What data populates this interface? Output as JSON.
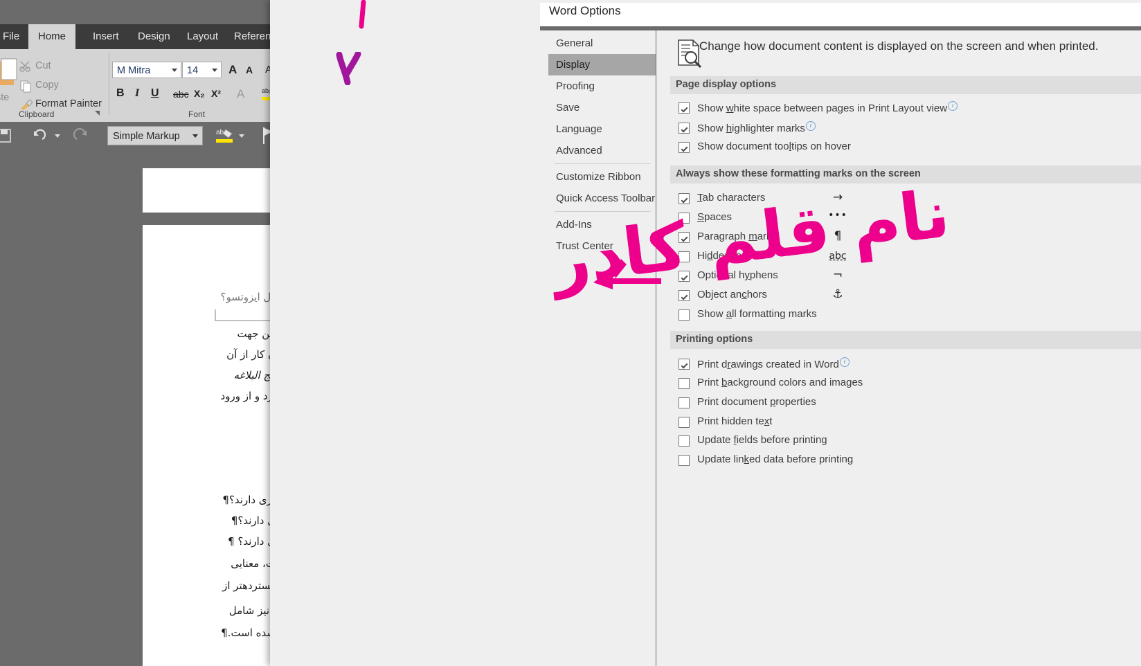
{
  "colors": {
    "ink_pink": "#ec008c",
    "ink_purple": "#a0179c",
    "accent_teal": "#11bf9a",
    "dialog_bg": "#efefef",
    "section_bg": "#dedede",
    "nav_selected": "#a6a6a6"
  },
  "word": {
    "tabs": [
      {
        "label": "File",
        "active": false
      },
      {
        "label": "Home",
        "active": true
      },
      {
        "label": "Insert",
        "active": false
      },
      {
        "label": "Design",
        "active": false
      },
      {
        "label": "Layout",
        "active": false
      },
      {
        "label": "References",
        "active": false
      }
    ],
    "clipboard": {
      "group_label": "Clipboard",
      "paste_label": "ste",
      "cut_label": "Cut",
      "copy_label": "Copy",
      "format_painter_label": "Format Painter",
      "cut_icon": "scissors-icon",
      "copy_icon": "copy-icon",
      "format_painter_icon": "paintbrush-icon",
      "dialog_launcher_icon": "dialog-launcher-icon"
    },
    "font_group": {
      "group_label": "Font",
      "font_name": "M Mitra",
      "font_size": "14",
      "grow_font": "A",
      "shrink_font": "A",
      "change_case": "Aa",
      "bold": "B",
      "italic": "I",
      "underline": "U",
      "strikethrough": "abc",
      "subscript": "X₂",
      "superscript": "X²",
      "text_effects": "A",
      "highlight_icon": "text-highlight-icon"
    },
    "quick_access": {
      "save_icon": "save-icon",
      "undo_icon": "undo-icon",
      "redo_icon": "redo-icon",
      "markup_value": "Simple Markup",
      "highlight_icon": "text-highlight-icon",
      "flag_icon": "flag-icon"
    },
    "document_lines": [
      {
        "text": "دل ایزوتسو؟",
        "style": "gray"
      },
      {
        "text": "این جهت",
        "style": "normal"
      },
      {
        "text": "ن کار از آن",
        "style": "normal"
      },
      {
        "text": "هج البلاغه",
        "style": "italic"
      },
      {
        "text": "ارد و از ورود",
        "style": "normal"
      },
      {
        "text": "یری دارند؟¶",
        "style": "normal"
      },
      {
        "text": "ی دارند؟¶",
        "style": "normal"
      },
      {
        "text": "ی دارند؟ ¶",
        "style": "normal"
      },
      {
        "text": "ت، معنایی",
        "style": "normal"
      },
      {
        "text": "گستردهتر از",
        "style": "normal"
      },
      {
        "text": "ا نیز شامل",
        "style": "normal"
      },
      {
        "text": "شده است.¶",
        "style": "normal"
      }
    ]
  },
  "dialog": {
    "title": "Word Options",
    "help_button": "?",
    "close_button": "✕",
    "header_icon": "document-search-icon",
    "header_text": "Change how document content is displayed on the screen and when printed.",
    "nav": {
      "groups": [
        {
          "items": [
            {
              "label": "General",
              "selected": false
            },
            {
              "label": "Display",
              "selected": true
            },
            {
              "label": "Proofing",
              "selected": false
            },
            {
              "label": "Save",
              "selected": false
            },
            {
              "label": "Language",
              "selected": false
            },
            {
              "label": "Advanced",
              "selected": false
            }
          ]
        },
        {
          "items": [
            {
              "label": "Customize Ribbon",
              "selected": false
            },
            {
              "label": "Quick Access Toolbar",
              "selected": false
            }
          ]
        },
        {
          "items": [
            {
              "label": "Add-Ins",
              "selected": false
            },
            {
              "label": "Trust Center",
              "selected": false
            }
          ]
        }
      ]
    },
    "sections": [
      {
        "title": "Page display options",
        "items": [
          {
            "label_pre": "Show ",
            "label_key": "w",
            "label_post": "hite space between pages in Print Layout view",
            "checked": true,
            "info": true,
            "mark": ""
          },
          {
            "label_pre": "Show ",
            "label_key": "h",
            "label_post": "ighlighter marks",
            "checked": true,
            "info": true,
            "mark": ""
          },
          {
            "label_pre": "Show document too",
            "label_key": "l",
            "label_post": "tips on hover",
            "checked": true,
            "info": false,
            "mark": ""
          }
        ]
      },
      {
        "title": "Always show these formatting marks on the screen",
        "items": [
          {
            "label_pre": "",
            "label_key": "T",
            "label_post": "ab characters",
            "checked": true,
            "info": false,
            "mark": "→",
            "mark_kind": "arrow"
          },
          {
            "label_pre": "",
            "label_key": "S",
            "label_post": "paces",
            "checked": false,
            "info": false,
            "mark": "•••",
            "mark_kind": "dots"
          },
          {
            "label_pre": "Paragraph ",
            "label_key": "m",
            "label_post": "arks",
            "checked": true,
            "info": false,
            "mark": "¶",
            "mark_kind": "pilcrow"
          },
          {
            "label_pre": "Hi",
            "label_key": "d",
            "label_post": "den text",
            "checked": false,
            "info": false,
            "mark": "abc",
            "mark_kind": "abc"
          },
          {
            "label_pre": "Optional h",
            "label_key": "y",
            "label_post": "phens",
            "checked": true,
            "info": false,
            "mark": "¬",
            "mark_kind": "hyphen"
          },
          {
            "label_pre": "Object an",
            "label_key": "c",
            "label_post": "hors",
            "checked": true,
            "info": false,
            "mark": "⚓",
            "mark_kind": "anchor"
          },
          {
            "label_pre": "Show ",
            "label_key": "a",
            "label_post": "ll formatting marks",
            "checked": false,
            "info": false,
            "mark": ""
          }
        ]
      },
      {
        "title": "Printing options",
        "items": [
          {
            "label_pre": "Print d",
            "label_key": "r",
            "label_post": "awings created in Word",
            "checked": true,
            "info": true,
            "mark": ""
          },
          {
            "label_pre": "Print ",
            "label_key": "b",
            "label_post": "ackground colors and images",
            "checked": false,
            "info": false,
            "mark": ""
          },
          {
            "label_pre": "Print document ",
            "label_key": "p",
            "label_post": "roperties",
            "checked": false,
            "info": false,
            "mark": ""
          },
          {
            "label_pre": "Print hidden te",
            "label_key": "x",
            "label_post": "t",
            "checked": false,
            "info": false,
            "mark": ""
          },
          {
            "label_pre": "Update ",
            "label_key": "f",
            "label_post": "ields before printing",
            "checked": false,
            "info": false,
            "mark": ""
          },
          {
            "label_pre": "Update lin",
            "label_key": "k",
            "label_post": "ed data before printing",
            "checked": false,
            "info": false,
            "mark": ""
          }
        ]
      }
    ]
  },
  "annotations": {
    "title_stroke": {
      "name": "ink-stroke-title",
      "color": "#ec008c"
    },
    "display_check": {
      "name": "ink-checkmark-display",
      "color": "#a0179c"
    },
    "arrow": {
      "name": "ink-arrow-left",
      "color": "#ec008c"
    },
    "handwriting": {
      "name": "ink-handwriting-persian",
      "text": "نام قلم کادر",
      "color": "#ec008c"
    }
  }
}
